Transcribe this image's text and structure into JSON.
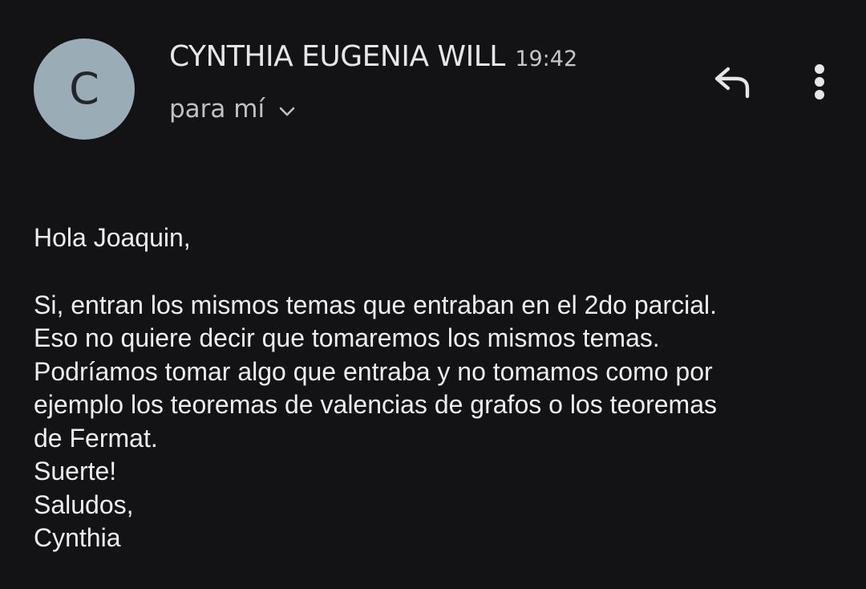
{
  "message": {
    "avatar_letter": "C",
    "sender_name": "CYNTHIA EUGENIA WILL",
    "time": "19:42",
    "recipient_label": "para mí",
    "greeting": "Hola Joaquin,",
    "body_lines": [
      "Si, entran los mismos temas que entraban en el 2do parcial.",
      "Eso no quiere decir que tomaremos los mismos temas.",
      "Podríamos tomar algo que entraba y no tomamos como por",
      "ejemplo los teoremas de valencias de grafos o los teoremas",
      "de Fermat.",
      "Suerte!",
      "Saludos,",
      "Cynthia"
    ]
  },
  "actions": {
    "reply_icon": "reply-icon",
    "more_icon": "more-vert-icon",
    "expand_icon": "chevron-down-icon"
  },
  "colors": {
    "background": "#131316",
    "avatar_bg": "#9aadb6",
    "text": "#eeeef0",
    "secondary_text": "#bfc1c4"
  }
}
